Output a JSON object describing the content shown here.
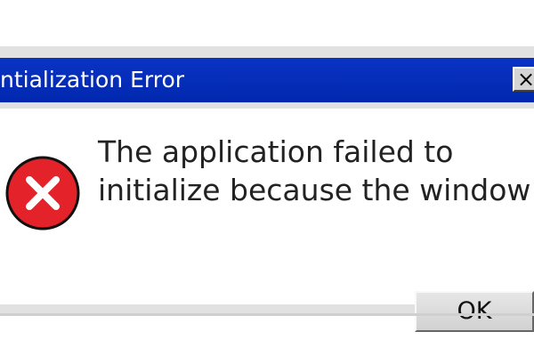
{
  "dialog": {
    "title": "ntialization Error",
    "close_symbol": "×",
    "icon": "error-circle-icon",
    "message_lines": [
      "The application failed to",
      "initialize because the window"
    ],
    "ok_label": "OK"
  },
  "colors": {
    "titlebar": "#0028ae",
    "dialog_frame": "#e1e1e1",
    "error_red": "#e3222a",
    "button_face": "#d8d8d8"
  }
}
